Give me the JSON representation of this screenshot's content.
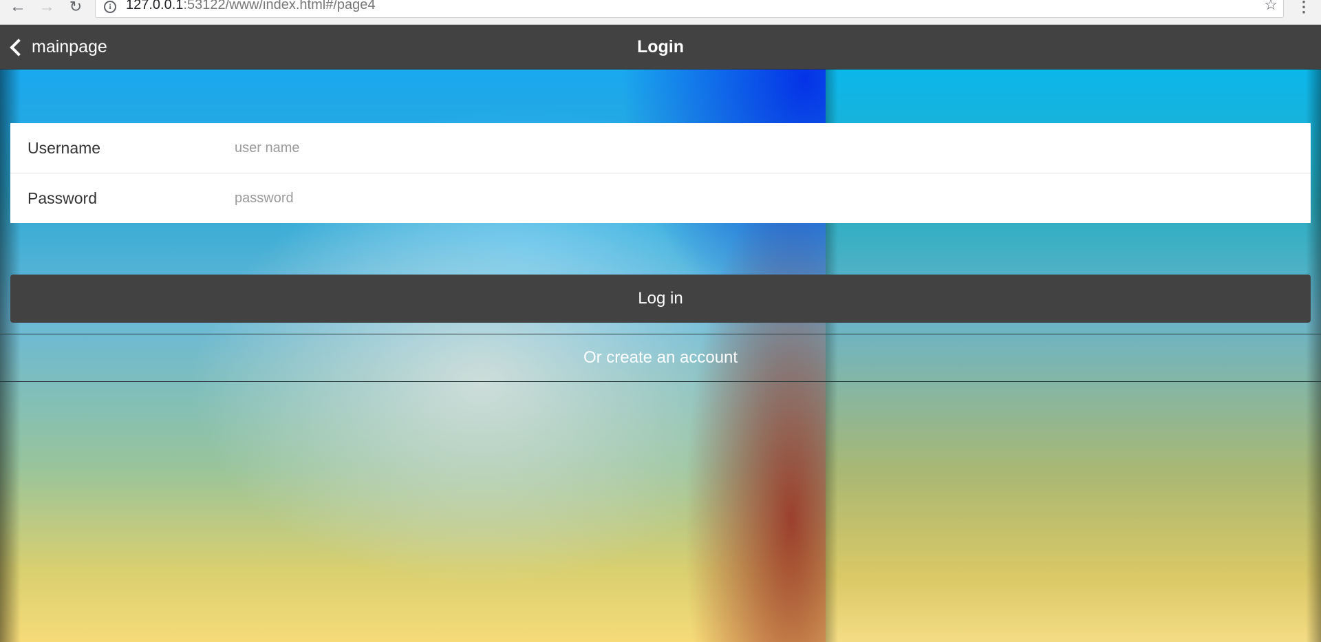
{
  "browser": {
    "url_host": "127.0.0.1",
    "url_rest": ":53122/www/index.html#/page4"
  },
  "toolbar": {
    "back_label": "mainpage",
    "title": "Login"
  },
  "form": {
    "username_label": "Username",
    "username_placeholder": "user name",
    "password_label": "Password",
    "password_placeholder": "password"
  },
  "actions": {
    "login_label": "Log in",
    "create_account_label": "Or create an account"
  },
  "colors": {
    "toolbar": "#424242",
    "login_button": "#424242",
    "form_background": "#ffffff"
  }
}
